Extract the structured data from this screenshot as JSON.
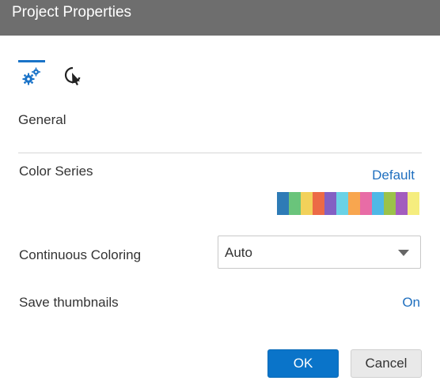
{
  "dialog": {
    "title": "Project Properties"
  },
  "tabs": [
    {
      "name": "general",
      "icon": "gears-icon",
      "active": true
    },
    {
      "name": "interaction",
      "icon": "cursor-click-icon",
      "active": false
    }
  ],
  "general": {
    "heading": "General",
    "color_series": {
      "label": "Color Series",
      "link": "Default",
      "swatches": [
        "#2e7bb6",
        "#6ac47b",
        "#f2d15a",
        "#ec6a46",
        "#8360c3",
        "#6ad2e6",
        "#f8a64f",
        "#e86ca6",
        "#4fb8e6",
        "#9bc24a",
        "#a35dbe",
        "#f5ed7e"
      ]
    },
    "continuous_coloring": {
      "label": "Continuous Coloring",
      "value": "Auto"
    },
    "save_thumbnails": {
      "label": "Save thumbnails",
      "value": "On"
    }
  },
  "footer": {
    "ok_label": "OK",
    "cancel_label": "Cancel"
  },
  "colors": {
    "accent": "#0a74c9",
    "titlebar": "#6e6e6e",
    "link": "#1f6fbf"
  }
}
